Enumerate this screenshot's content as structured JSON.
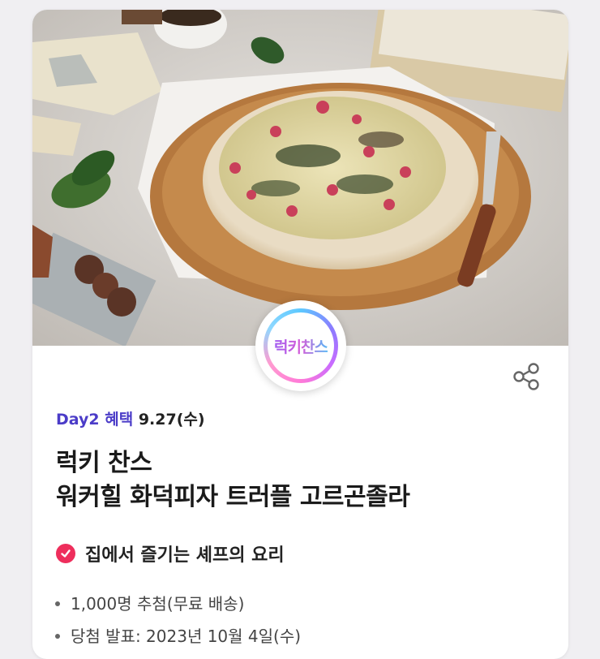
{
  "event": {
    "badge_label": "럭키찬스",
    "share_icon": "share-icon",
    "day_label": "Day2 혜택",
    "date_label": "9.27(수)",
    "title_line1": "럭키 찬스",
    "title_line2": "워커힐 화덕피자 트러플 고르곤졸라",
    "feature_icon": "check-circle-icon",
    "feature_text": "집에서 즐기는 셰프의 요리",
    "details": [
      "1,000명 추첨(무료 배송)",
      "당첨 발표: 2023년 10월 4일(수)"
    ]
  },
  "colors": {
    "accent": "#4b3cc8",
    "check": "#ee2e5c",
    "background": "#f0eff2"
  }
}
